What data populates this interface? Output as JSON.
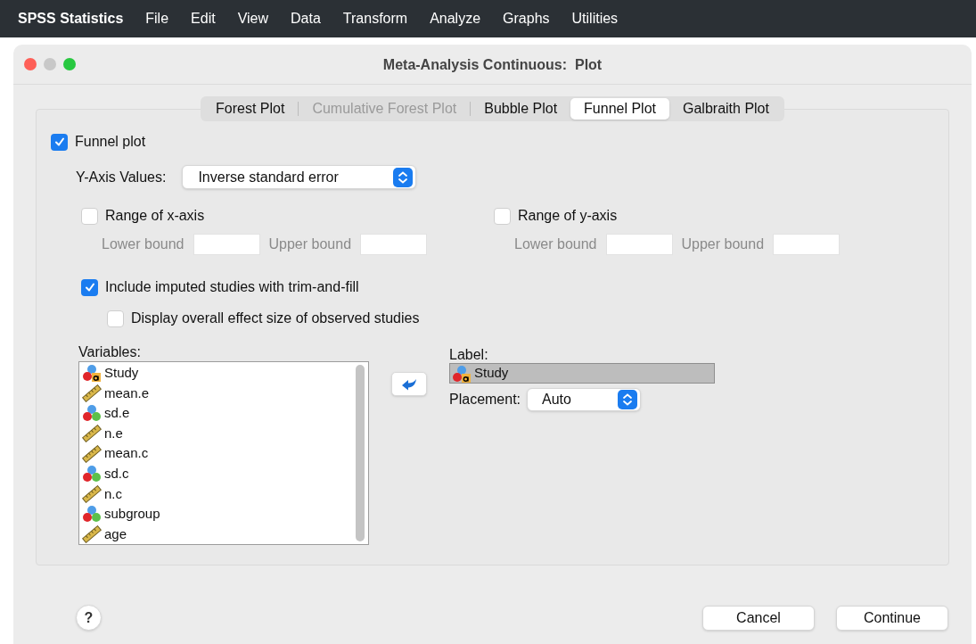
{
  "menu_bar": {
    "app_name": "SPSS Statistics",
    "items": [
      "File",
      "Edit",
      "View",
      "Data",
      "Transform",
      "Analyze",
      "Graphs",
      "Utilities"
    ]
  },
  "window": {
    "title": "Meta-Analysis Continuous:  Plot"
  },
  "tabs": [
    {
      "label": "Forest Plot",
      "selected": false,
      "disabled": false
    },
    {
      "label": "Cumulative Forest Plot",
      "selected": false,
      "disabled": true
    },
    {
      "label": "Bubble Plot",
      "selected": false,
      "disabled": false
    },
    {
      "label": "Funnel Plot",
      "selected": true,
      "disabled": false
    },
    {
      "label": "Galbraith Plot",
      "selected": false,
      "disabled": false
    }
  ],
  "funnel_plot": {
    "label": "Funnel plot",
    "checked": true
  },
  "y_axis_values": {
    "label": "Y-Axis Values:",
    "value": "Inverse standard error"
  },
  "ranges": [
    {
      "label": "Range of x-axis",
      "checked": false,
      "lower_label": "Lower bound",
      "upper_label": "Upper bound"
    },
    {
      "label": "Range of y-axis",
      "checked": false,
      "lower_label": "Lower bound",
      "upper_label": "Upper bound"
    }
  ],
  "trim_and_fill": {
    "label": "Include imputed studies with trim-and-fill",
    "checked": true
  },
  "display_observed": {
    "label": "Display overall effect size of observed studies",
    "checked": false
  },
  "variables": {
    "label": "Variables:",
    "items": [
      {
        "name": "Study",
        "kind": "string"
      },
      {
        "name": "mean.e",
        "kind": "scale"
      },
      {
        "name": "sd.e",
        "kind": "nominal"
      },
      {
        "name": "n.e",
        "kind": "scale"
      },
      {
        "name": "mean.c",
        "kind": "scale"
      },
      {
        "name": "sd.c",
        "kind": "nominal"
      },
      {
        "name": "n.c",
        "kind": "scale"
      },
      {
        "name": "subgroup",
        "kind": "nominal"
      },
      {
        "name": "age",
        "kind": "scale"
      }
    ]
  },
  "label_field": {
    "label": "Label:",
    "value": {
      "name": "Study",
      "kind": "string"
    }
  },
  "placement": {
    "label": "Placement:",
    "value": "Auto"
  },
  "buttons": {
    "help": "?",
    "cancel": "Cancel",
    "continue": "Continue"
  }
}
